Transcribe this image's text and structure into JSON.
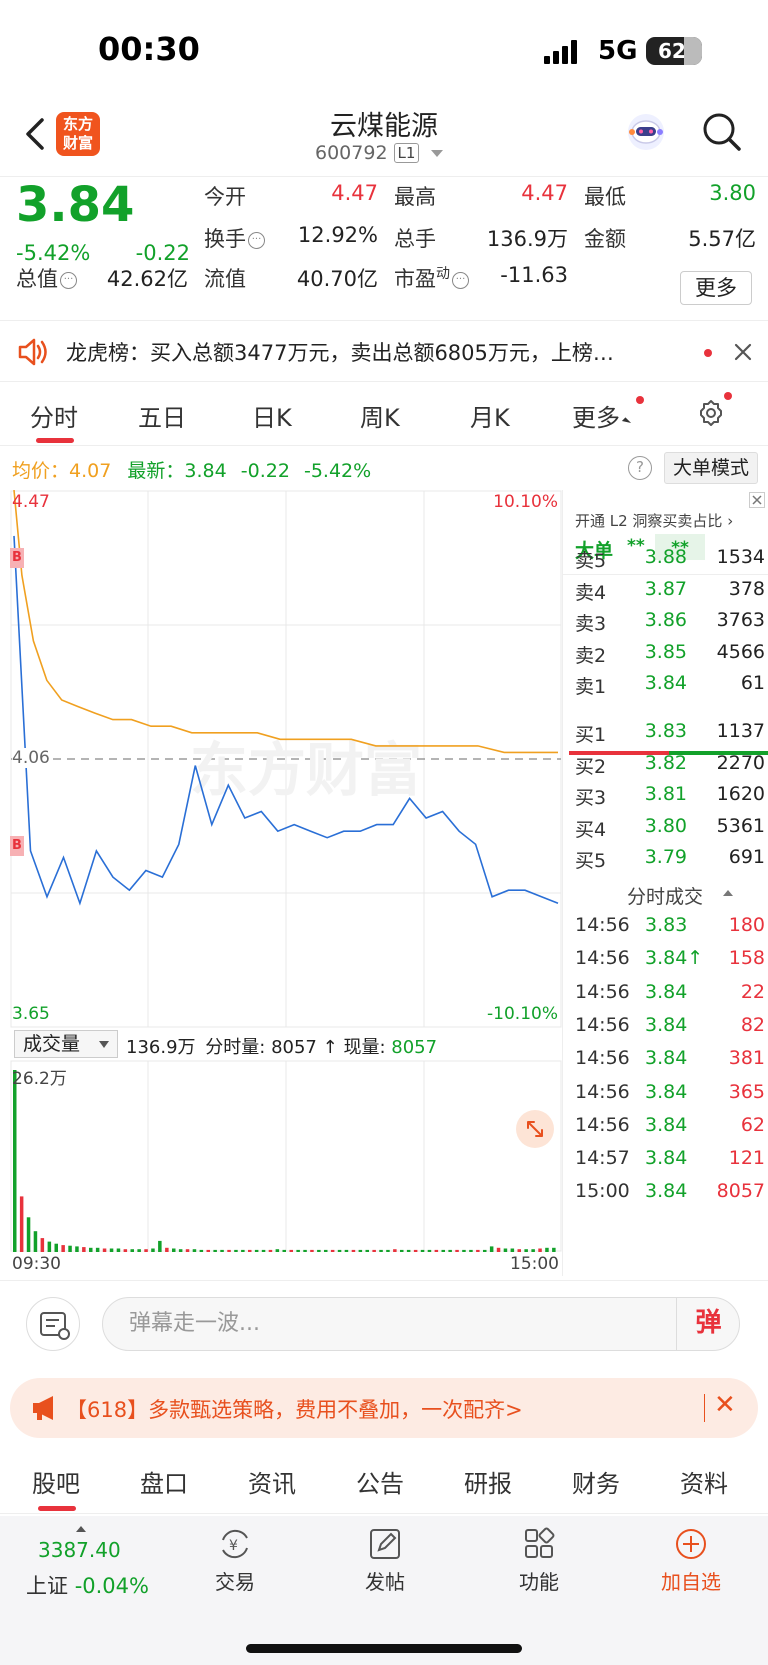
{
  "status_bar": {
    "time": "00:30",
    "network": "5G",
    "battery": "62"
  },
  "header": {
    "logo_line1": "东方",
    "logo_line2": "财富",
    "stock_name": "云煤能源",
    "stock_code": "600792",
    "level": "L1"
  },
  "quote": {
    "price": "3.84",
    "change_pct": "-5.42%",
    "change_val": "-0.22",
    "open_label": "今开",
    "open": "4.47",
    "high_label": "最高",
    "high": "4.47",
    "low_label": "最低",
    "low": "3.80",
    "turnover_label": "换手",
    "turnover": "12.92%",
    "volume_label": "总手",
    "volume": "136.9万",
    "amount_label": "金额",
    "amount": "5.57亿",
    "mcap_label": "总值",
    "mcap": "42.62亿",
    "float_label": "流值",
    "float_cap": "40.70亿",
    "pe_label": "市盈",
    "pe_sup": "动",
    "pe": "-11.63",
    "more_label": "更多"
  },
  "announcement": {
    "text": "龙虎榜：买入总额3477万元，卖出总额6805万元，上榜…"
  },
  "period_tabs": [
    "分时",
    "五日",
    "日K",
    "周K",
    "月K",
    "更多"
  ],
  "chart_head": {
    "avg_label": "均价：",
    "avg": "4.07",
    "latest_label": "最新：",
    "latest": "3.84",
    "latest_change": "-0.22",
    "latest_pct": "-5.42%",
    "mode_button": "大单模式",
    "help": "?"
  },
  "chart_labels": {
    "y_top": "4.47",
    "y_mid": "4.06",
    "y_bottom": "3.65",
    "pct_top": "10.10%",
    "pct_bottom": "-10.10%",
    "marker": "B",
    "watermark": "东方财富",
    "vol_max": "26.2万",
    "x_start": "09:30",
    "x_end": "15:00"
  },
  "volume_bar": {
    "selector": "成交量",
    "total": "136.9万",
    "fenshi_label": "分时量:",
    "fenshi": "8057",
    "current_label": "现量:",
    "current": "8057"
  },
  "chart_data": {
    "type": "line",
    "title": "",
    "ylim": [
      3.65,
      4.47
    ],
    "prev_close": 4.06,
    "x": [
      "09:30",
      "15:00"
    ],
    "series": [
      {
        "name": "均价",
        "color": "#f0a020",
        "values": [
          4.47,
          4.34,
          4.24,
          4.18,
          4.15,
          4.14,
          4.13,
          4.12,
          4.12,
          4.11,
          4.11,
          4.1,
          4.1,
          4.1,
          4.1,
          4.09,
          4.09,
          4.09,
          4.09,
          4.08,
          4.08,
          4.08,
          4.08,
          4.08,
          4.07,
          4.07,
          4.07
        ]
      },
      {
        "name": "最新",
        "color": "#2a6fd6",
        "values": [
          4.4,
          3.92,
          3.85,
          3.91,
          3.84,
          3.92,
          3.88,
          3.86,
          3.89,
          3.88,
          3.93,
          4.05,
          3.96,
          4.02,
          3.97,
          3.98,
          3.95,
          3.96,
          3.95,
          3.94,
          3.95,
          3.95,
          3.96,
          3.96,
          4.0,
          3.97,
          3.98,
          3.95,
          3.93,
          3.85,
          3.86,
          3.86,
          3.85,
          3.84
        ]
      }
    ]
  },
  "volume_chart": {
    "values": [
      26.2,
      8,
      5,
      3,
      2,
      1.5,
      1.2,
      1,
      0.9,
      0.8,
      0.7,
      0.6,
      0.6,
      0.5,
      0.5,
      0.5,
      0.4,
      0.4,
      0.4,
      0.4,
      0.5,
      1.6,
      0.6,
      0.5,
      0.4,
      0.4,
      0.4,
      0.3,
      0.3,
      0.3,
      0.3,
      0.3,
      0.3,
      0.3,
      0.3,
      0.3,
      0.3,
      0.3,
      0.4,
      0.3,
      0.3,
      0.3,
      0.3,
      0.3,
      0.3,
      0.3,
      0.3,
      0.3,
      0.3,
      0.3,
      0.3,
      0.3,
      0.3,
      0.3,
      0.3,
      0.4,
      0.3,
      0.3,
      0.3,
      0.3,
      0.3,
      0.3,
      0.3,
      0.3,
      0.3,
      0.3,
      0.3,
      0.3,
      0.3,
      0.8,
      0.6,
      0.5,
      0.5,
      0.4,
      0.4,
      0.4,
      0.5,
      0.6,
      0.6
    ]
  },
  "orderbook": {
    "l2_label": "开通 L2 洞察买卖占比 ›",
    "dadan_label": "大单",
    "dadan_v1": "**",
    "dadan_v2": "**",
    "asks": [
      {
        "label": "卖5",
        "price": "3.88",
        "vol": "1534"
      },
      {
        "label": "卖4",
        "price": "3.87",
        "vol": "378"
      },
      {
        "label": "卖3",
        "price": "3.86",
        "vol": "3763"
      },
      {
        "label": "卖2",
        "price": "3.85",
        "vol": "4566"
      },
      {
        "label": "卖1",
        "price": "3.84",
        "vol": "61"
      }
    ],
    "bids": [
      {
        "label": "买1",
        "price": "3.83",
        "vol": "1137"
      },
      {
        "label": "买2",
        "price": "3.82",
        "vol": "2270"
      },
      {
        "label": "买3",
        "price": "3.81",
        "vol": "1620"
      },
      {
        "label": "买4",
        "price": "3.80",
        "vol": "5361"
      },
      {
        "label": "买5",
        "price": "3.79",
        "vol": "691"
      }
    ],
    "ticks_title": "分时成交",
    "ticks": [
      {
        "time": "14:56",
        "price": "3.83",
        "vol": "180"
      },
      {
        "time": "14:56",
        "price": "3.84↑",
        "vol": "158"
      },
      {
        "time": "14:56",
        "price": "3.84",
        "vol": "22"
      },
      {
        "time": "14:56",
        "price": "3.84",
        "vol": "82"
      },
      {
        "time": "14:56",
        "price": "3.84",
        "vol": "381"
      },
      {
        "time": "14:56",
        "price": "3.84",
        "vol": "365"
      },
      {
        "time": "14:56",
        "price": "3.84",
        "vol": "62"
      },
      {
        "time": "14:57",
        "price": "3.84",
        "vol": "121"
      },
      {
        "time": "15:00",
        "price": "3.84",
        "vol": "8057"
      }
    ]
  },
  "comment_bar": {
    "placeholder": "弹幕走一波...",
    "danmu": "弹"
  },
  "promo": {
    "text": "【618】多款甄选策略，费用不叠加，一次配齐>",
    "close": "✕"
  },
  "bottom_tabs": [
    "股吧",
    "盘口",
    "资讯",
    "公告",
    "研报",
    "财务",
    "资料"
  ],
  "nav": {
    "index_value": "3387.40",
    "index_name": "上证",
    "index_pct": "-0.04%",
    "items": [
      "交易",
      "发帖",
      "功能",
      "加自选"
    ]
  },
  "colors": {
    "up": "#e8323c",
    "down": "#12a12a",
    "avg_line": "#f0a020",
    "price_line": "#2a6fd6",
    "brand": "#f0541e"
  }
}
